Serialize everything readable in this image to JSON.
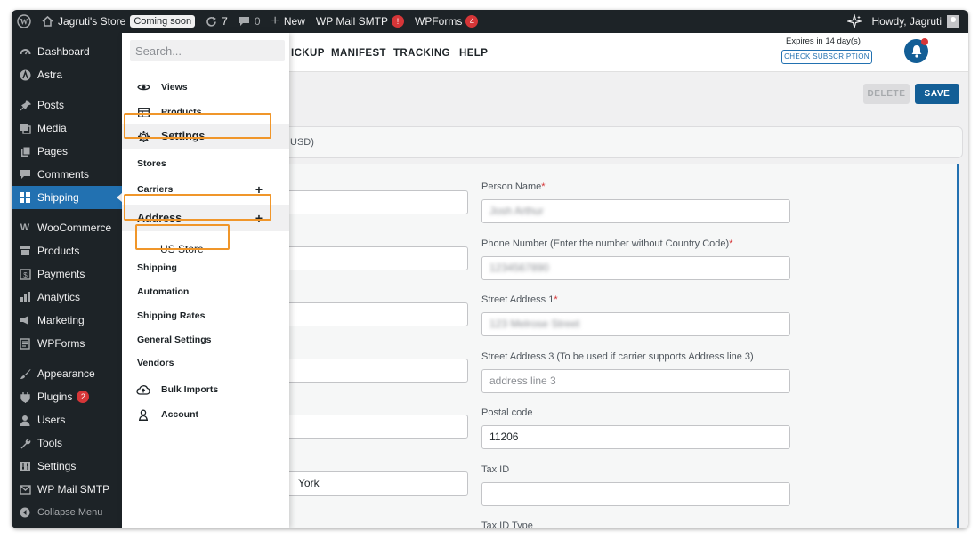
{
  "admin_bar": {
    "site_name": "Jagruti's Store",
    "coming_soon": "Coming soon",
    "updates_count": "7",
    "comments_count": "0",
    "new_label": "New",
    "wp_mail_smtp": "WP Mail SMTP",
    "wp_mail_smtp_badge": "!",
    "wpforms": "WPForms",
    "wpforms_badge": "4",
    "howdy": "Howdy, Jagruti"
  },
  "sidebar": {
    "dashboard": "Dashboard",
    "astra": "Astra",
    "posts": "Posts",
    "media": "Media",
    "pages": "Pages",
    "comments": "Comments",
    "shipping": "Shipping",
    "woocommerce": "WooCommerce",
    "products": "Products",
    "payments": "Payments",
    "analytics": "Analytics",
    "marketing": "Marketing",
    "wpforms": "WPForms",
    "appearance": "Appearance",
    "plugins": "Plugins",
    "plugins_badge": "2",
    "users": "Users",
    "tools": "Tools",
    "settings": "Settings",
    "wp_mail_smtp": "WP Mail SMTP",
    "collapse": "Collapse Menu"
  },
  "top_nav": {
    "pickup": "ICKUP",
    "manifest": "MANIFEST",
    "tracking": "TRACKING",
    "help": "HELP",
    "expires": "Expires in 14 day(s)",
    "check_subscription": "CHECK SUBSCRIPTION"
  },
  "actions": {
    "delete": "DELETE",
    "save": "SAVE"
  },
  "currency_fragment": "USD)",
  "form": {
    "person_name_label": "Person Name",
    "person_name_value": "Josh Arthur",
    "phone_label": "Phone Number (Enter the number without Country Code)",
    "phone_value": "1234567890",
    "street1_label": "Street Address 1",
    "street1_value": "123 Melrose Street",
    "street3_label": "Street Address 3 (To be used if carrier supports Address line 3)",
    "street3_placeholder": "address line 3",
    "postal_label": "Postal code",
    "postal_value": "11206",
    "tax_id_label": "Tax ID",
    "tax_id_type_label": "Tax ID Type",
    "city_fragment": "York",
    "required_mark": "*"
  },
  "dropdown": {
    "search_placeholder": "Search...",
    "views": "Views",
    "products": "Products",
    "settings": "Settings",
    "stores": "Stores",
    "carriers": "Carriers",
    "address": "Address",
    "us_store": "US Store",
    "shipping": "Shipping",
    "automation": "Automation",
    "shipping_rates": "Shipping Rates",
    "general_settings": "General Settings",
    "vendors": "Vendors",
    "bulk_imports": "Bulk Imports",
    "account": "Account",
    "plus": "+"
  },
  "colors": {
    "admin_dark": "#1d2327",
    "accent_blue": "#2271b1",
    "save_blue": "#135e96",
    "highlight_orange": "#f0962a",
    "badge_red": "#d63638"
  }
}
